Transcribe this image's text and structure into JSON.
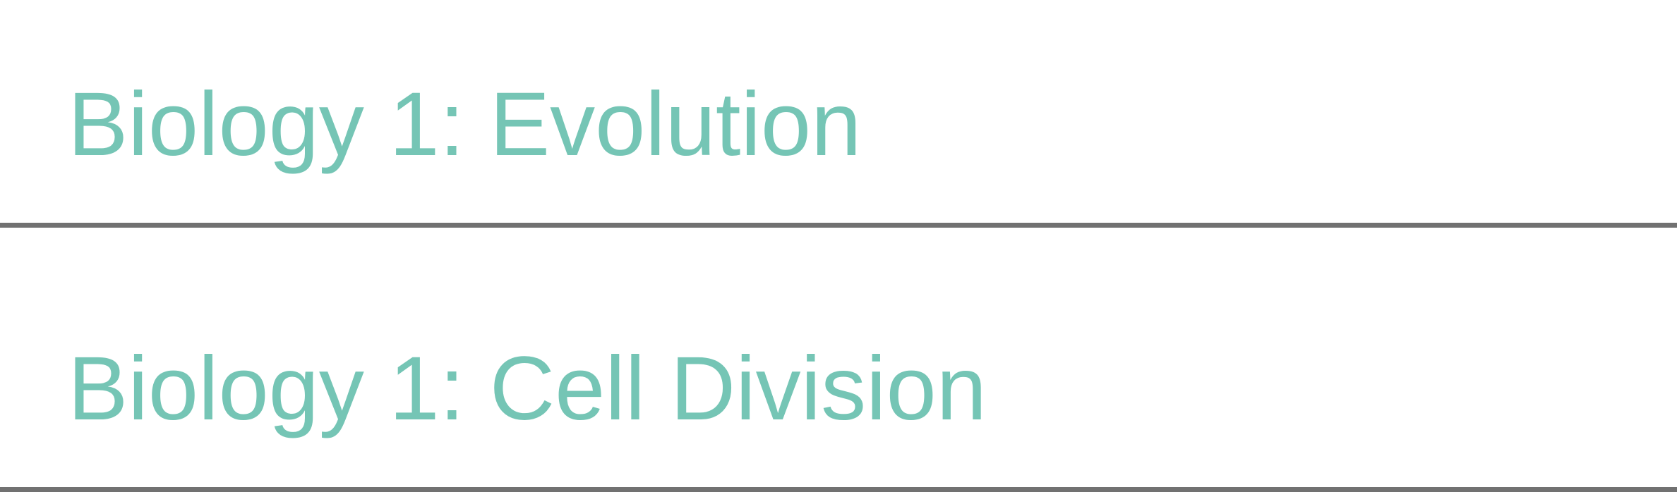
{
  "theme": {
    "accent": "#75c5b5",
    "divider": "#717171",
    "background": "#ffffff"
  },
  "list": {
    "items": [
      {
        "label": "Biology 1: Evolution"
      },
      {
        "label": "Biology 1: Cell Division"
      }
    ]
  }
}
